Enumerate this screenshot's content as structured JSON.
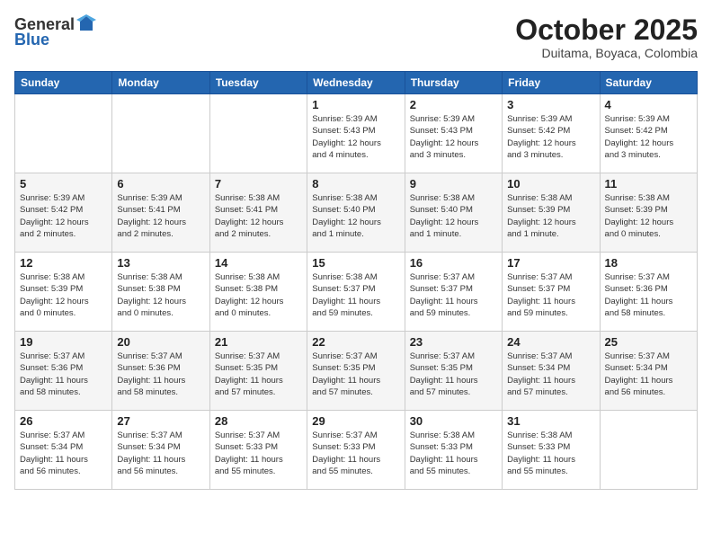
{
  "header": {
    "logo_general": "General",
    "logo_blue": "Blue",
    "month_title": "October 2025",
    "subtitle": "Duitama, Boyaca, Colombia"
  },
  "days_of_week": [
    "Sunday",
    "Monday",
    "Tuesday",
    "Wednesday",
    "Thursday",
    "Friday",
    "Saturday"
  ],
  "weeks": [
    [
      {
        "day": "",
        "info": ""
      },
      {
        "day": "",
        "info": ""
      },
      {
        "day": "",
        "info": ""
      },
      {
        "day": "1",
        "info": "Sunrise: 5:39 AM\nSunset: 5:43 PM\nDaylight: 12 hours\nand 4 minutes."
      },
      {
        "day": "2",
        "info": "Sunrise: 5:39 AM\nSunset: 5:43 PM\nDaylight: 12 hours\nand 3 minutes."
      },
      {
        "day": "3",
        "info": "Sunrise: 5:39 AM\nSunset: 5:42 PM\nDaylight: 12 hours\nand 3 minutes."
      },
      {
        "day": "4",
        "info": "Sunrise: 5:39 AM\nSunset: 5:42 PM\nDaylight: 12 hours\nand 3 minutes."
      }
    ],
    [
      {
        "day": "5",
        "info": "Sunrise: 5:39 AM\nSunset: 5:42 PM\nDaylight: 12 hours\nand 2 minutes."
      },
      {
        "day": "6",
        "info": "Sunrise: 5:39 AM\nSunset: 5:41 PM\nDaylight: 12 hours\nand 2 minutes."
      },
      {
        "day": "7",
        "info": "Sunrise: 5:38 AM\nSunset: 5:41 PM\nDaylight: 12 hours\nand 2 minutes."
      },
      {
        "day": "8",
        "info": "Sunrise: 5:38 AM\nSunset: 5:40 PM\nDaylight: 12 hours\nand 1 minute."
      },
      {
        "day": "9",
        "info": "Sunrise: 5:38 AM\nSunset: 5:40 PM\nDaylight: 12 hours\nand 1 minute."
      },
      {
        "day": "10",
        "info": "Sunrise: 5:38 AM\nSunset: 5:39 PM\nDaylight: 12 hours\nand 1 minute."
      },
      {
        "day": "11",
        "info": "Sunrise: 5:38 AM\nSunset: 5:39 PM\nDaylight: 12 hours\nand 0 minutes."
      }
    ],
    [
      {
        "day": "12",
        "info": "Sunrise: 5:38 AM\nSunset: 5:39 PM\nDaylight: 12 hours\nand 0 minutes."
      },
      {
        "day": "13",
        "info": "Sunrise: 5:38 AM\nSunset: 5:38 PM\nDaylight: 12 hours\nand 0 minutes."
      },
      {
        "day": "14",
        "info": "Sunrise: 5:38 AM\nSunset: 5:38 PM\nDaylight: 12 hours\nand 0 minutes."
      },
      {
        "day": "15",
        "info": "Sunrise: 5:38 AM\nSunset: 5:37 PM\nDaylight: 11 hours\nand 59 minutes."
      },
      {
        "day": "16",
        "info": "Sunrise: 5:37 AM\nSunset: 5:37 PM\nDaylight: 11 hours\nand 59 minutes."
      },
      {
        "day": "17",
        "info": "Sunrise: 5:37 AM\nSunset: 5:37 PM\nDaylight: 11 hours\nand 59 minutes."
      },
      {
        "day": "18",
        "info": "Sunrise: 5:37 AM\nSunset: 5:36 PM\nDaylight: 11 hours\nand 58 minutes."
      }
    ],
    [
      {
        "day": "19",
        "info": "Sunrise: 5:37 AM\nSunset: 5:36 PM\nDaylight: 11 hours\nand 58 minutes."
      },
      {
        "day": "20",
        "info": "Sunrise: 5:37 AM\nSunset: 5:36 PM\nDaylight: 11 hours\nand 58 minutes."
      },
      {
        "day": "21",
        "info": "Sunrise: 5:37 AM\nSunset: 5:35 PM\nDaylight: 11 hours\nand 57 minutes."
      },
      {
        "day": "22",
        "info": "Sunrise: 5:37 AM\nSunset: 5:35 PM\nDaylight: 11 hours\nand 57 minutes."
      },
      {
        "day": "23",
        "info": "Sunrise: 5:37 AM\nSunset: 5:35 PM\nDaylight: 11 hours\nand 57 minutes."
      },
      {
        "day": "24",
        "info": "Sunrise: 5:37 AM\nSunset: 5:34 PM\nDaylight: 11 hours\nand 57 minutes."
      },
      {
        "day": "25",
        "info": "Sunrise: 5:37 AM\nSunset: 5:34 PM\nDaylight: 11 hours\nand 56 minutes."
      }
    ],
    [
      {
        "day": "26",
        "info": "Sunrise: 5:37 AM\nSunset: 5:34 PM\nDaylight: 11 hours\nand 56 minutes."
      },
      {
        "day": "27",
        "info": "Sunrise: 5:37 AM\nSunset: 5:34 PM\nDaylight: 11 hours\nand 56 minutes."
      },
      {
        "day": "28",
        "info": "Sunrise: 5:37 AM\nSunset: 5:33 PM\nDaylight: 11 hours\nand 55 minutes."
      },
      {
        "day": "29",
        "info": "Sunrise: 5:37 AM\nSunset: 5:33 PM\nDaylight: 11 hours\nand 55 minutes."
      },
      {
        "day": "30",
        "info": "Sunrise: 5:38 AM\nSunset: 5:33 PM\nDaylight: 11 hours\nand 55 minutes."
      },
      {
        "day": "31",
        "info": "Sunrise: 5:38 AM\nSunset: 5:33 PM\nDaylight: 11 hours\nand 55 minutes."
      },
      {
        "day": "",
        "info": ""
      }
    ]
  ]
}
